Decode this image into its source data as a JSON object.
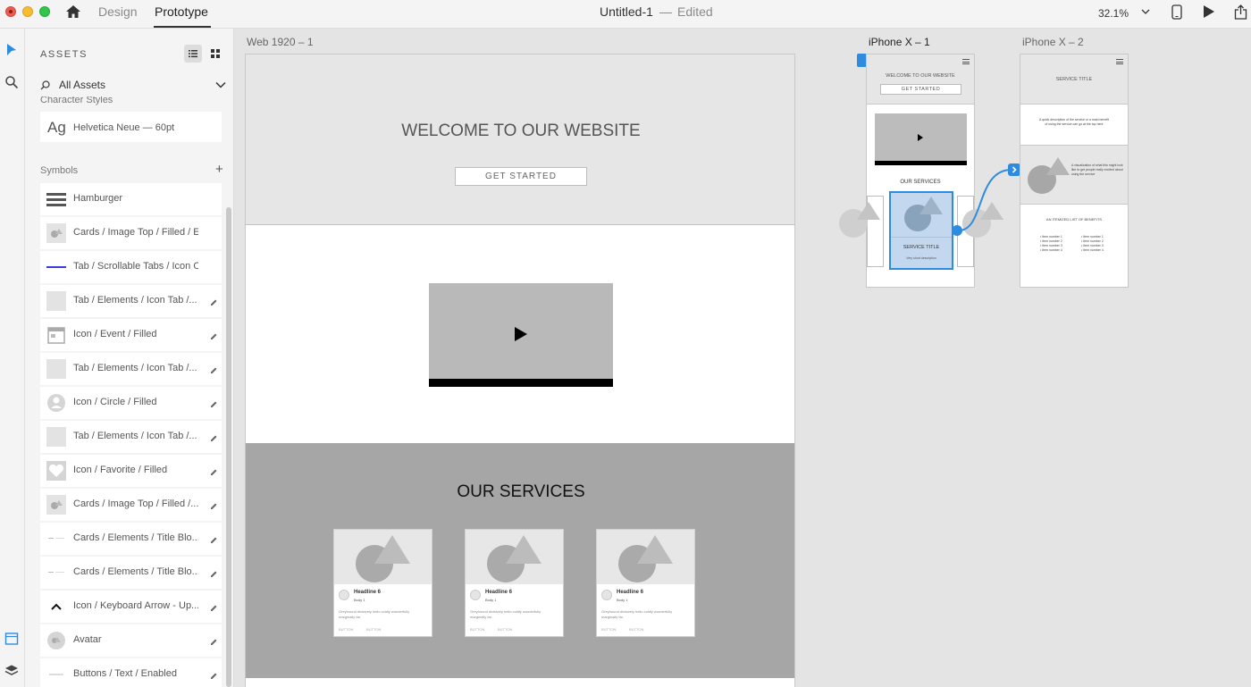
{
  "topbar": {
    "tabs": [
      "Design",
      "Prototype"
    ],
    "active_tab": "Prototype",
    "doc_title": "Untitled-1",
    "doc_separator": "—",
    "doc_status": "Edited",
    "zoom": "32.1%"
  },
  "assets": {
    "title": "ASSETS",
    "filter": "All Assets",
    "character_styles_heading": "Character Styles",
    "char_style": {
      "preview": "Ag",
      "label": "Helvetica Neue — 60pt"
    },
    "symbols_heading": "Symbols",
    "symbols": [
      {
        "label": "Hamburger",
        "thumb": "hamburger-icon"
      },
      {
        "label": "Cards / Image Top / Filled / Exp...",
        "thumb": "card-thumb"
      },
      {
        "label": "Tab / Scrollable Tabs / Icon Onl...",
        "thumb": "tab-bar-thumb"
      },
      {
        "label": "Tab / Elements / Icon Tab /...",
        "thumb": "tab-thumb"
      },
      {
        "label": "Icon / Event / Filled",
        "thumb": "event-icon"
      },
      {
        "label": "Tab / Elements / Icon Tab /...",
        "thumb": "tab-thumb"
      },
      {
        "label": "Icon / Circle / Filled",
        "thumb": "person-circle-icon"
      },
      {
        "label": "Tab / Elements / Icon Tab /...",
        "thumb": "tab-thumb"
      },
      {
        "label": "Icon / Favorite / Filled",
        "thumb": "heart-icon"
      },
      {
        "label": "Cards / Image Top / Filled /...",
        "thumb": "card-thumb"
      },
      {
        "label": "Cards / Elements / Title Blo...",
        "thumb": "title-block-thumb"
      },
      {
        "label": "Cards / Elements / Title Blo...",
        "thumb": "title-block-thumb"
      },
      {
        "label": "Icon / Keyboard Arrow - Up...",
        "thumb": "chevron-up-icon"
      },
      {
        "label": "Avatar",
        "thumb": "avatar-thumb"
      },
      {
        "label": "Buttons / Text / Enabled",
        "thumb": "text-button-thumb"
      }
    ]
  },
  "canvas": {
    "web_label": "Web 1920 – 1",
    "iphone1_label": "iPhone X – 1",
    "iphone2_label": "iPhone X – 2",
    "web": {
      "hero_title": "WELCOME TO OUR WEBSITE",
      "hero_button": "GET STARTED",
      "services_title": "OUR SERVICES",
      "cards": [
        {
          "headline": "Headline 6",
          "sub": "Body 1",
          "body": "Greyhound divisively hello coldly wonderfully marginally far.",
          "actions": [
            "BUTTON",
            "BUTTON"
          ]
        },
        {
          "headline": "Headline 6",
          "sub": "Body 1",
          "body": "Greyhound divisively hello coldly wonderfully marginally far.",
          "actions": [
            "BUTTON",
            "BUTTON"
          ]
        },
        {
          "headline": "Headline 6",
          "sub": "Body 1",
          "body": "Greyhound divisively hello coldly wonderfully marginally far.",
          "actions": [
            "BUTTON",
            "BUTTON"
          ]
        }
      ]
    },
    "iphone1": {
      "hero_title": "WELCOME TO OUR WEBSITE",
      "hero_button": "GET STARTED",
      "services_title": "OUR SERVICES",
      "selected_card_title": "SERVICE TITLE",
      "selected_card_desc": "Very short description"
    },
    "iphone2": {
      "hero_title": "SERVICE TITLE",
      "description": "A quick description of the service or a main benefit of using the service can go at the top here",
      "visual_text": "A visualization of what this might look like to get people really excited about using the service",
      "list_title": "AN ITEMIZED LIST OF BENEFITS",
      "list_left": [
        "• Item number 1",
        "• Item number 2",
        "• Item number 3",
        "• Item number 4"
      ],
      "list_right": [
        "• Item number 1",
        "• Item number 2",
        "• Item number 3",
        "• Item number 4"
      ]
    }
  },
  "colors": {
    "accent": "#2d8ce0",
    "selection_fill": "#c3d8ef",
    "services_bg": "#a6a6a6",
    "hero_bg": "#e6e6e6"
  }
}
